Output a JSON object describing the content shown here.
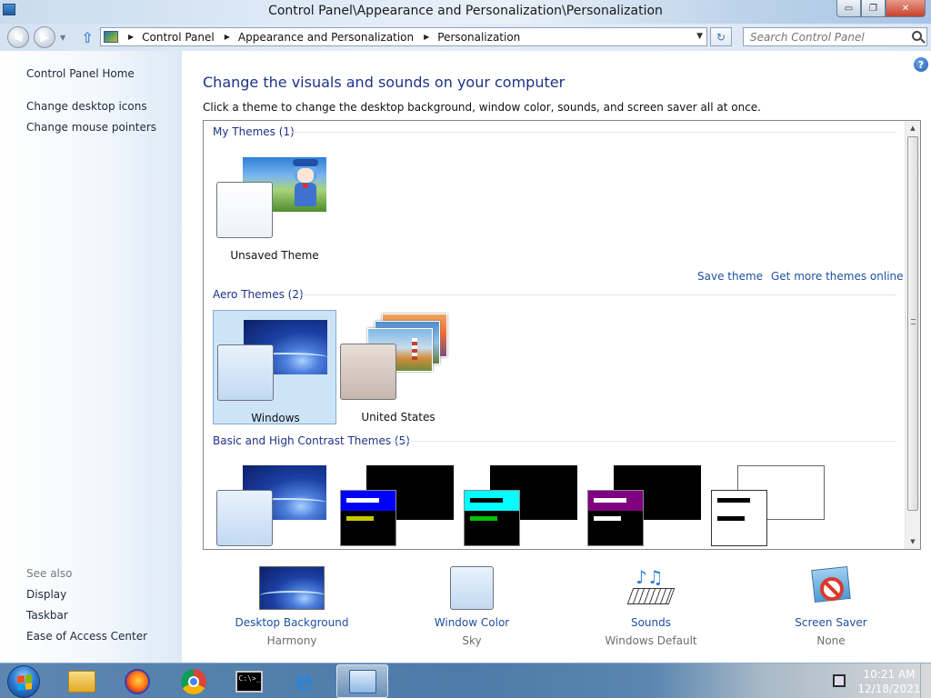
{
  "window": {
    "title": "Control Panel\\Appearance and Personalization\\Personalization",
    "buttons": {
      "minimize": "▭",
      "restore": "❐",
      "close": "✕"
    }
  },
  "navbar": {
    "back_icon": "◀",
    "forward_icon": "▶",
    "breadcrumbs": [
      "Control Panel",
      "Appearance and Personalization",
      "Personalization"
    ],
    "search_placeholder": "Search Control Panel"
  },
  "sidebar": {
    "home": "Control Panel Home",
    "tasks": [
      "Change desktop icons",
      "Change mouse pointers"
    ],
    "see_also_label": "See also",
    "see_also": [
      "Display",
      "Taskbar",
      "Ease of Access Center"
    ]
  },
  "main": {
    "title": "Change the visuals and sounds on your computer",
    "description": "Click a theme to change the desktop background, window color, sounds, and screen saver all at once.",
    "sections": {
      "my_themes": {
        "label": "My Themes (1)",
        "themes": [
          {
            "name": "Unsaved Theme"
          }
        ],
        "links": {
          "save": "Save theme",
          "more": "Get more themes online"
        }
      },
      "aero_themes": {
        "label": "Aero Themes (2)",
        "themes": [
          {
            "name": "Windows",
            "selected": true
          },
          {
            "name": "United States"
          }
        ]
      },
      "basic_themes": {
        "label": "Basic and High Contrast Themes (5)"
      }
    },
    "settings": [
      {
        "label": "Desktop Background",
        "value": "Harmony",
        "icon": "desktop-background-icon"
      },
      {
        "label": "Window Color",
        "value": "Sky",
        "icon": "window-color-icon"
      },
      {
        "label": "Sounds",
        "value": "Windows Default",
        "icon": "sounds-icon"
      },
      {
        "label": "Screen Saver",
        "value": "None",
        "icon": "screen-saver-icon"
      }
    ]
  },
  "taskbar": {
    "apps": [
      "Windows Explorer",
      "Firefox",
      "Chrome",
      "Command Prompt",
      "Internet Explorer",
      "Control Panel"
    ],
    "cmd_prompt": "C:\\>_",
    "time": "10:21 AM",
    "date": "12/18/2021"
  },
  "colors": {
    "link": "#1e50a2",
    "heading": "#1e3287",
    "selected_bg": "#cde4f7",
    "hc_colors": [
      "#0000ff",
      "#00ffff",
      "#800080",
      "#000000"
    ]
  }
}
